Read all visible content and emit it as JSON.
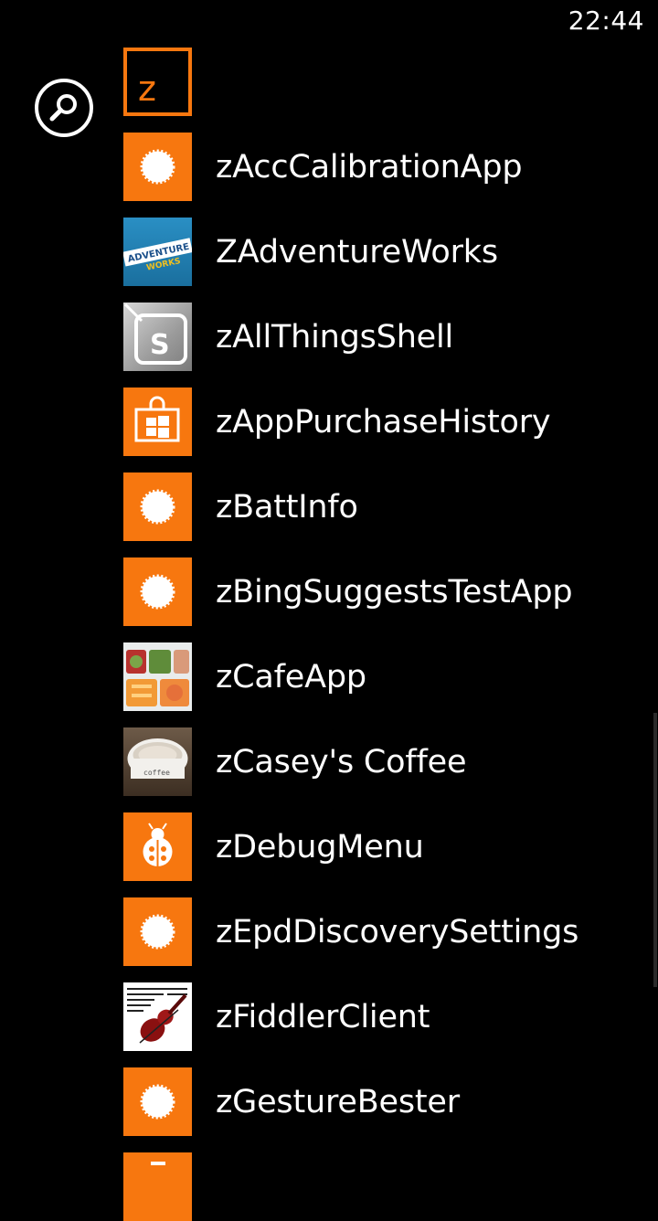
{
  "status": {
    "time": "22:44"
  },
  "search": {
    "icon": "search-icon"
  },
  "group_letter": "z",
  "colors": {
    "accent": "#f7770f",
    "background": "#000000",
    "text": "#ffffff"
  },
  "apps": [
    {
      "label": "zAccCalibrationApp",
      "icon": "gear-icon"
    },
    {
      "label": "ZAdventureWorks",
      "icon": "adventure-works-logo-icon"
    },
    {
      "label": "zAllThingsShell",
      "icon": "shell-s-icon"
    },
    {
      "label": "zAppPurchaseHistory",
      "icon": "store-bag-icon"
    },
    {
      "label": "zBattInfo",
      "icon": "gear-icon"
    },
    {
      "label": "zBingSuggestsTestApp",
      "icon": "gear-icon"
    },
    {
      "label": "zCafeApp",
      "icon": "food-tray-icon"
    },
    {
      "label": "zCasey's Coffee",
      "icon": "coffee-cup-icon"
    },
    {
      "label": "zDebugMenu",
      "icon": "ladybug-icon"
    },
    {
      "label": "zEpdDiscoverySettings",
      "icon": "gear-icon"
    },
    {
      "label": "zFiddlerClient",
      "icon": "violin-icon"
    },
    {
      "label": "zGestureBester",
      "icon": "gear-icon"
    },
    {
      "label": "",
      "icon": "gear-icon"
    }
  ]
}
